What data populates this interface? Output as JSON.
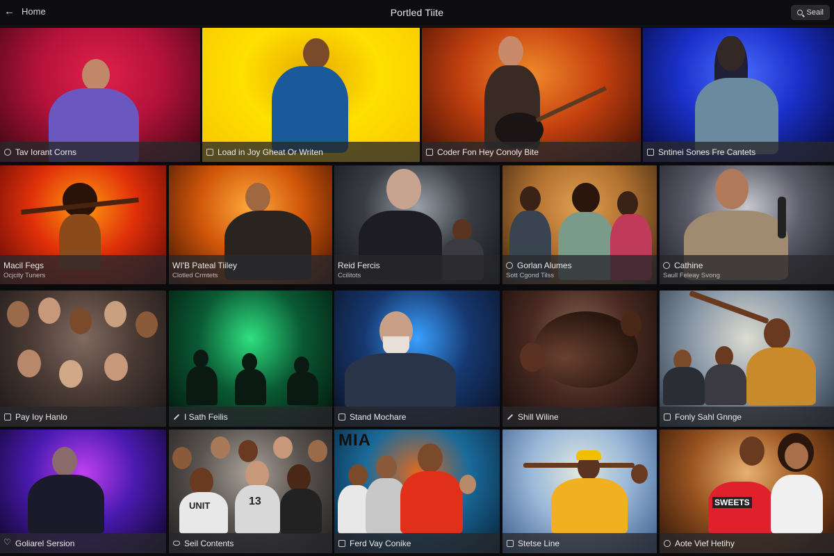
{
  "header": {
    "back_label": "Home",
    "title": "Portled Tiite",
    "search_label": "Seail"
  },
  "rows": [
    {
      "tiles": [
        {
          "title": "Tav Iorant Corns",
          "icon": "gear-icon",
          "colors": [
            "#3a0610",
            "#b3123a",
            "#e0204a"
          ]
        },
        {
          "title": "Load in Joy Gheat Or Writen",
          "icon": "image-icon",
          "colors": [
            "#f6c400",
            "#ffe000",
            "#e8a800"
          ]
        },
        {
          "title": "Coder Fon Hey Conoly Bite",
          "icon": "folder-icon",
          "colors": [
            "#3b0d04",
            "#c4400f",
            "#f08a2a"
          ]
        },
        {
          "title": "Sntinei Sones Fre Cantets",
          "icon": "screen-icon",
          "colors": [
            "#05083a",
            "#1a30c8",
            "#4a6cff"
          ]
        }
      ]
    },
    {
      "tiles": [
        {
          "title": "Macil Fegs",
          "subtitle": "Ocjcity Tuners",
          "icon": "",
          "colors": [
            "#5a0505",
            "#e0300a",
            "#ff9a10"
          ]
        },
        {
          "title": "WI'B Pateal Tiiley",
          "subtitle": "Clotled Crmtets",
          "icon": "",
          "colors": [
            "#3a1002",
            "#d0560a",
            "#ffa83a"
          ]
        },
        {
          "title": "Reid Fercis",
          "subtitle": "Ccilitots",
          "icon": "",
          "colors": [
            "#111418",
            "#3a3e44",
            "#9aa0a8"
          ]
        },
        {
          "title": "Gorlan Alumes",
          "subtitle": "Sott Cgond Tilss",
          "icon": "gear-icon",
          "colors": [
            "#3a2510",
            "#b07030",
            "#e0a050"
          ]
        },
        {
          "title": "Cathine",
          "subtitle": "Saull Feleay Svong",
          "icon": "gear-icon",
          "colors": [
            "#1c1c24",
            "#5c5c6a",
            "#c8c8d0"
          ]
        }
      ]
    },
    {
      "tiles": [
        {
          "title": "Pay Ioy Hanlo",
          "icon": "image-icon",
          "colors": [
            "#1a1616",
            "#4a3a34",
            "#806a60"
          ]
        },
        {
          "title": "I Sath Feilis",
          "icon": "pen-icon",
          "colors": [
            "#03120a",
            "#0a5a34",
            "#30e080"
          ]
        },
        {
          "title": "Stand Mochare",
          "icon": "image-icon",
          "colors": [
            "#0a1020",
            "#163870",
            "#3aa0ff"
          ]
        },
        {
          "title": "Shill Wiline",
          "icon": "pen-icon",
          "colors": [
            "#140c0a",
            "#4a2a22",
            "#8a6656"
          ]
        },
        {
          "title": "Fonly Sahl Gnnge",
          "icon": "image-icon",
          "colors": [
            "#283444",
            "#8a98a8",
            "#dcdcd0"
          ]
        }
      ]
    },
    {
      "tiles": [
        {
          "title": "Goliarel Sersion",
          "icon": "heart-icon",
          "colors": [
            "#0a0520",
            "#4a1ab0",
            "#c040f0"
          ]
        },
        {
          "title": "Seil Contents",
          "icon": "link-icon",
          "colors": [
            "#1e1c1c",
            "#5a5450",
            "#aaa29a"
          ]
        },
        {
          "title": "Ferd Vay Conike",
          "icon": "home-icon",
          "colors": [
            "#062036",
            "#1a6a9a",
            "#e06a20"
          ]
        },
        {
          "title": "Stetse Line",
          "icon": "image-icon",
          "colors": [
            "#3a5a8a",
            "#9ab8d8",
            "#e0e8e0"
          ]
        },
        {
          "title": "Aote Vief Hetihy",
          "icon": "gear-icon",
          "colors": [
            "#2a1208",
            "#9a5420",
            "#e8b070"
          ]
        }
      ]
    }
  ],
  "extra_text": {
    "poster_mia": "MIA",
    "shirt_unit": "UNIT",
    "shirt_13": "13",
    "shirt_sweets": "SWEETS"
  }
}
